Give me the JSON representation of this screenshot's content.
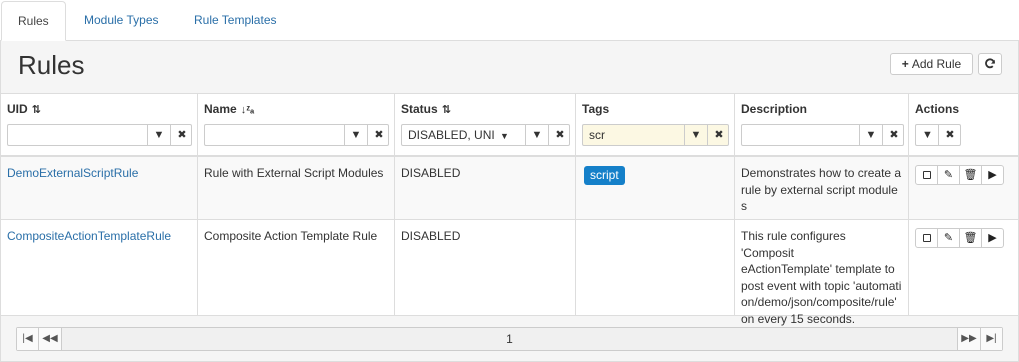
{
  "tabs": [
    {
      "label": "Rules",
      "active": true
    },
    {
      "label": "Module Types",
      "active": false
    },
    {
      "label": "Rule Templates",
      "active": false
    }
  ],
  "panel": {
    "title": "Rules",
    "add_button_label": "Add Rule"
  },
  "table": {
    "columns": [
      {
        "label": "UID",
        "sort_icon": "sort-amount-icon"
      },
      {
        "label": "Name",
        "sort_icon": "sort-alpha-icon"
      },
      {
        "label": "Status",
        "sort_icon": "sort-amount-icon"
      },
      {
        "label": "Tags"
      },
      {
        "label": "Description"
      },
      {
        "label": "Actions"
      }
    ],
    "filters": {
      "uid": "",
      "name": "",
      "status": "DISABLED, UNI",
      "tags": "scr",
      "description": ""
    },
    "rows": [
      {
        "uid": "DemoExternalScriptRule",
        "name": "Rule with External Script Modules",
        "status": "DISABLED",
        "tag": "script",
        "description_lines": [
          "Demonstrates how to create a",
          "rule by external script module",
          "s"
        ]
      },
      {
        "uid": "CompositeActionTemplateRule",
        "name": "Composite Action Template Rule",
        "status": "DISABLED",
        "tag": "",
        "description_lines": [
          "This rule configures 'Composit",
          "eActionTemplate' template to",
          "post event with topic 'automati",
          "on/demo/json/composite/rule'",
          "on every 15 seconds."
        ]
      }
    ]
  },
  "pager": {
    "page": "1"
  },
  "colors": {
    "link": "#2a6fa8",
    "tag_badge": "#1580c9",
    "tags_filter_highlight": "#fcf8e3"
  }
}
